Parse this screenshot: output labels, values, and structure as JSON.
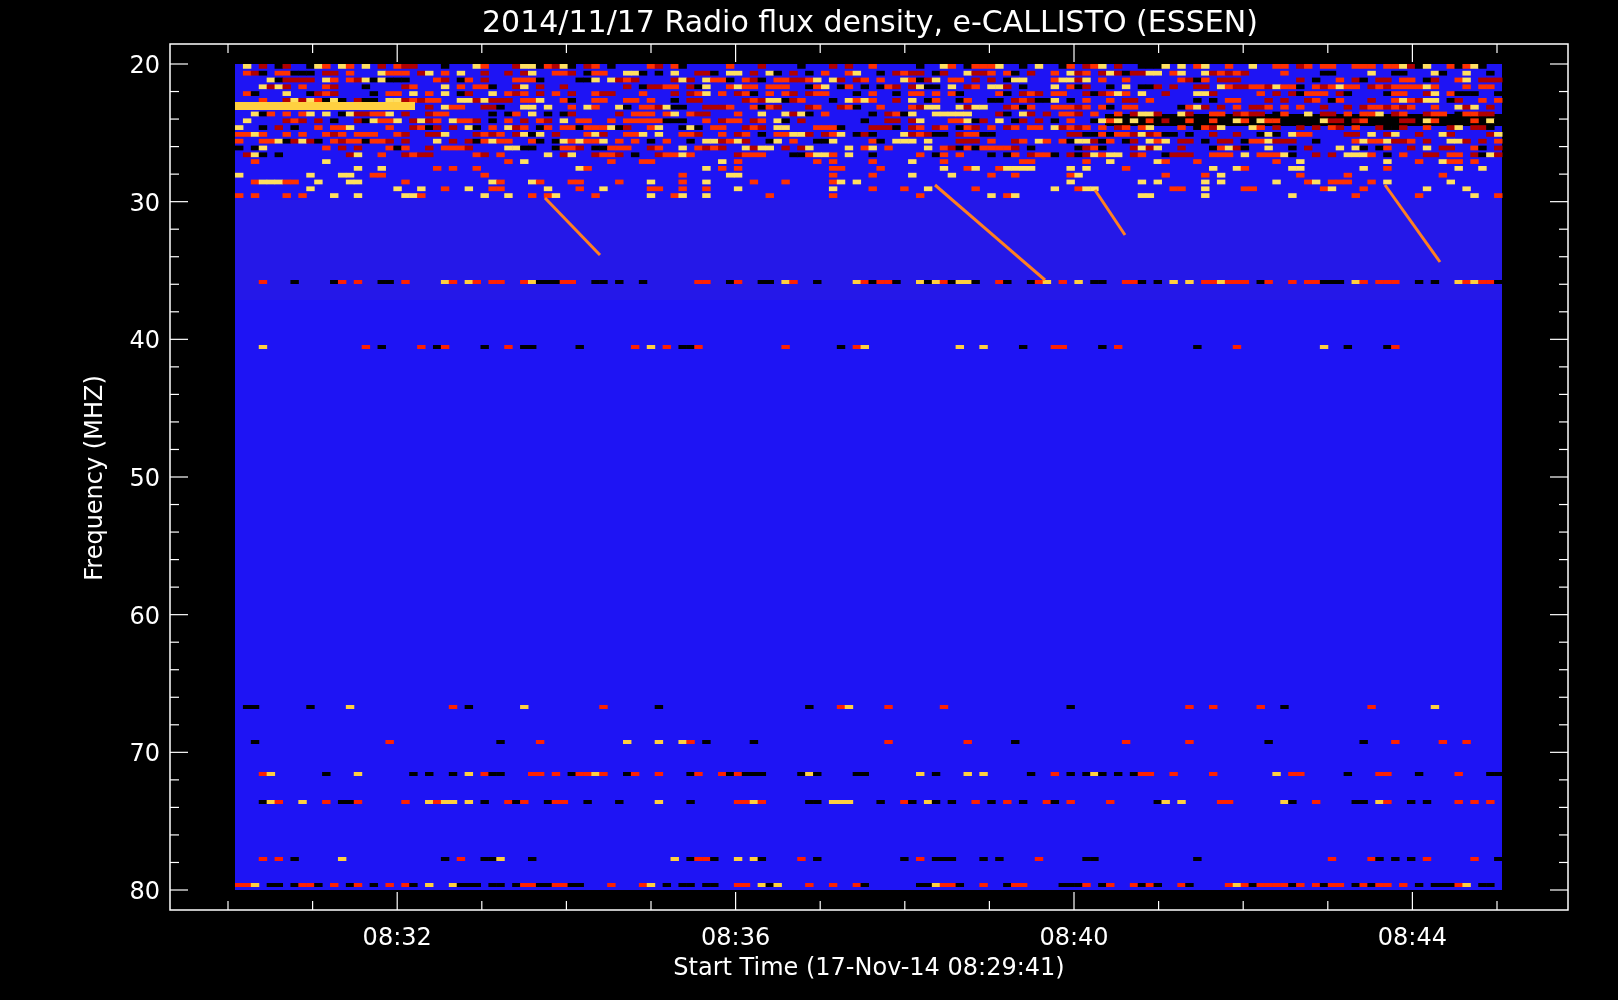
{
  "title": "2014/11/17  Radio flux density, e-CALLISTO (ESSEN)",
  "y_axis": {
    "label": "Frequency (MHZ)",
    "ticks": [
      "20",
      "30",
      "40",
      "50",
      "60",
      "70",
      "80"
    ]
  },
  "x_axis": {
    "label": "Start Time (17-Nov-14 08:29:41)",
    "ticks": [
      "08:32",
      "08:36",
      "08:40",
      "08:44"
    ]
  }
}
